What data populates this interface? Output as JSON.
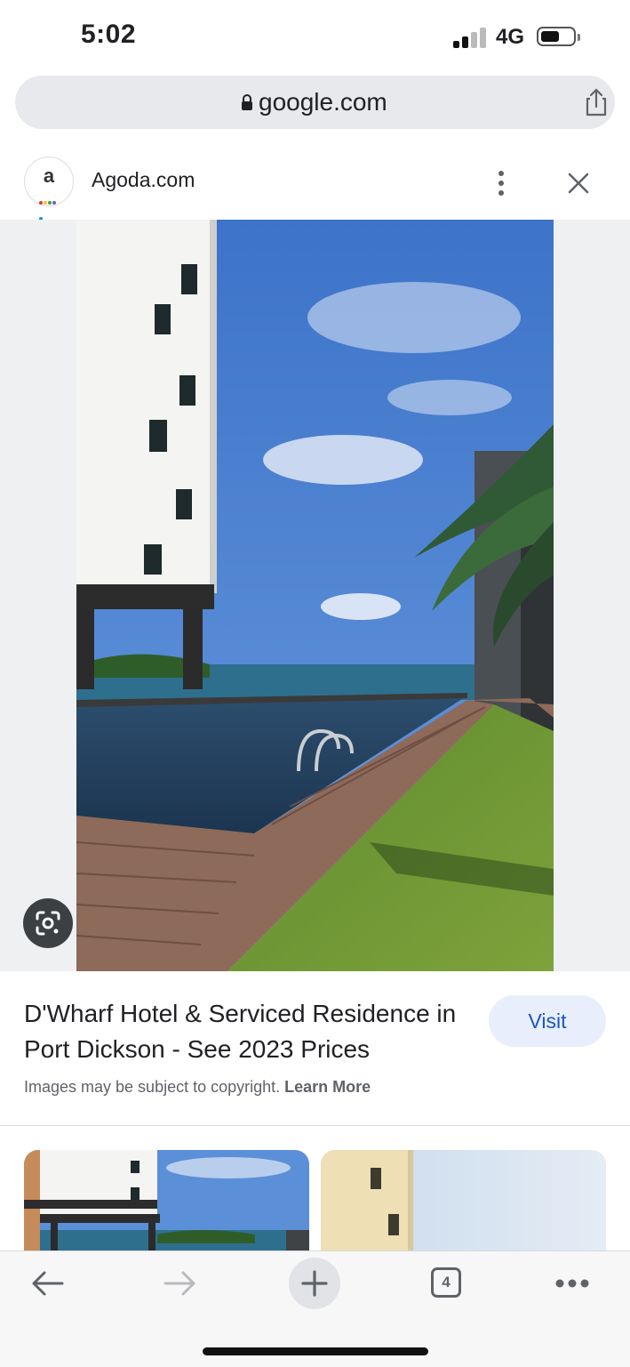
{
  "status_bar": {
    "time": "5:02",
    "network": "4G"
  },
  "browser": {
    "url": "google.com"
  },
  "source": {
    "site_name": "Agoda.com",
    "favicon_letter": "a"
  },
  "result": {
    "title": "D'Wharf Hotel & Serviced Residence in Port Dickson - See 2023 Prices",
    "visit_label": "Visit",
    "copyright_text": "Images may be subject to copyright.",
    "learn_more_label": "Learn More"
  },
  "toolbar": {
    "tab_count": "4"
  },
  "icons": [
    "lock-icon",
    "share-icon",
    "kebab-menu-icon",
    "close-icon",
    "lens-icon",
    "back-arrow-icon",
    "forward-arrow-icon",
    "plus-icon",
    "tabs-icon",
    "more-icon"
  ],
  "colors": {
    "visit_bg": "#e8eefb",
    "visit_text": "#1a56c4",
    "url_bar": "#e8e9ec"
  }
}
